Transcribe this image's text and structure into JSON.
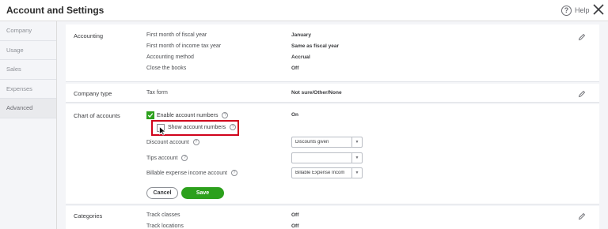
{
  "header": {
    "title": "Account and Settings",
    "help_label": "Help"
  },
  "sidebar": {
    "items": [
      {
        "label": "Company"
      },
      {
        "label": "Usage"
      },
      {
        "label": "Sales"
      },
      {
        "label": "Expenses"
      },
      {
        "label": "Advanced"
      }
    ]
  },
  "accounting": {
    "label": "Accounting",
    "fields": [
      {
        "label": "First month of fiscal year",
        "value": "January"
      },
      {
        "label": "First month of income tax year",
        "value": "Same as fiscal year"
      },
      {
        "label": "Accounting method",
        "value": "Accrual"
      },
      {
        "label": "Close the books",
        "value": "Off"
      }
    ]
  },
  "company_type": {
    "label": "Company type",
    "field_label": "Tax form",
    "field_value": "Not sure/Other/None"
  },
  "chart_of_accounts": {
    "label": "Chart of accounts",
    "enable_numbers_label": "Enable account numbers",
    "enable_numbers_value": "On",
    "show_numbers_label": "Show account numbers",
    "discount_label": "Discount account",
    "discount_value": "Discounts given",
    "tips_label": "Tips account",
    "tips_value": "",
    "billable_label": "Billable expense income account",
    "billable_value": "Billable Expense Incom",
    "cancel_label": "Cancel",
    "save_label": "Save"
  },
  "categories": {
    "label": "Categories",
    "fields": [
      {
        "label": "Track classes",
        "value": "Off"
      },
      {
        "label": "Track locations",
        "value": "Off"
      }
    ]
  },
  "colors": {
    "accent_green": "#2ca01c",
    "highlight_red": "#d0021b"
  },
  "icons": {
    "help": "question-circle-icon",
    "close": "close-icon",
    "edit": "pencil-icon",
    "info": "question-circle-icon",
    "dropdown": "caret-down-icon"
  }
}
